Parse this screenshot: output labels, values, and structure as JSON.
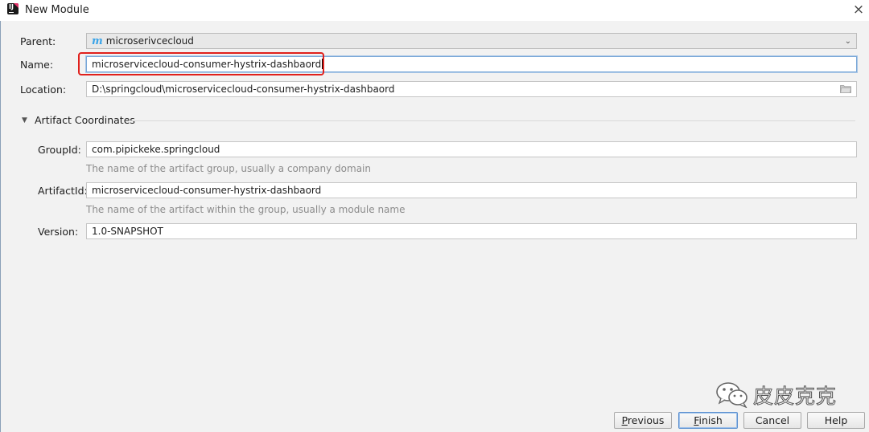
{
  "window": {
    "title": "New Module",
    "close_label": "×"
  },
  "form": {
    "parent": {
      "label": "Parent:",
      "value": "microserivcecloud",
      "icon_letter": "m"
    },
    "name": {
      "label": "Name:",
      "value": "microservicecloud-consumer-hystrix-dashbaord"
    },
    "location": {
      "label": "Location:",
      "value": "D:\\springcloud\\microservicecloud-consumer-hystrix-dashbaord"
    }
  },
  "artifact": {
    "section_title": "Artifact Coordinates",
    "group_id": {
      "label": "GroupId:",
      "value": "com.pipickeke.springcloud",
      "hint": "The name of the artifact group, usually a company domain"
    },
    "artifact_id": {
      "label": "ArtifactId:",
      "value": "microservicecloud-consumer-hystrix-dashbaord",
      "hint": "The name of the artifact within the group, usually a module name"
    },
    "version": {
      "label": "Version:",
      "value": "1.0-SNAPSHOT"
    }
  },
  "buttons": {
    "previous": {
      "mnemonic": "P",
      "rest": "revious"
    },
    "finish": {
      "mnemonic": "F",
      "rest": "inish"
    },
    "cancel": "Cancel",
    "help": "Help"
  },
  "watermark": {
    "text": "皮皮克克"
  },
  "colors": {
    "highlight_box": "#e0201c",
    "maven_icon": "#3ba4e8",
    "focus_border": "#7aa8d8"
  }
}
